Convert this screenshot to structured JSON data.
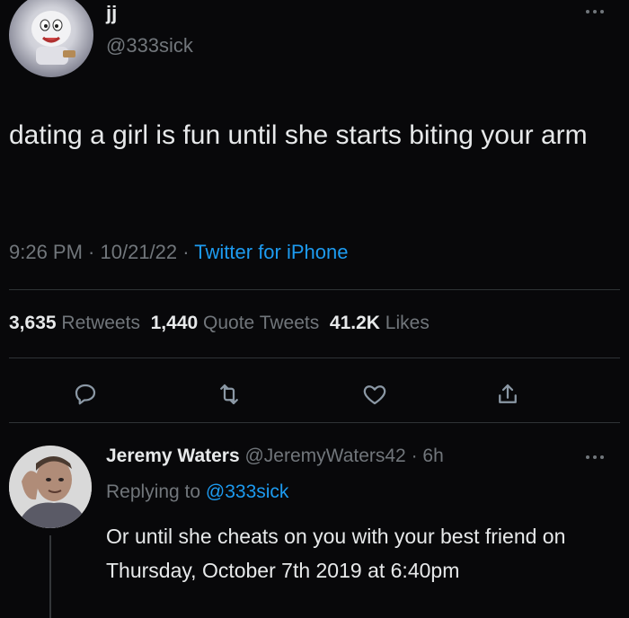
{
  "tweet": {
    "author_name": "jj",
    "author_handle": "@333sick",
    "text": "dating a girl is fun until she starts biting your arm",
    "time": "9:26 PM",
    "sep1": " · ",
    "date": "10/21/22",
    "sep2": " · ",
    "source": "Twitter for iPhone",
    "stats": {
      "retweets_count": "3,635",
      "retweets_label": "Retweets",
      "quotes_count": "1,440",
      "quotes_label": "Quote Tweets",
      "likes_count": "41.2K",
      "likes_label": "Likes"
    },
    "actions": [
      "reply-icon",
      "retweet-icon",
      "like-icon",
      "share-icon"
    ]
  },
  "reply": {
    "author_name": "Jeremy Waters",
    "author_handle": "@JeremyWaters42",
    "sep": " · ",
    "age": "6h",
    "replying_prefix": "Replying to ",
    "replying_to": "@333sick",
    "text": "Or until she cheats on you with your best friend on Thursday, October 7th 2019 at 6:40pm"
  },
  "colors": {
    "background": "#08080a",
    "text_primary": "#e7e9ea",
    "text_secondary": "#71767b",
    "accent": "#1d9bf0",
    "divider": "#2f3336"
  }
}
